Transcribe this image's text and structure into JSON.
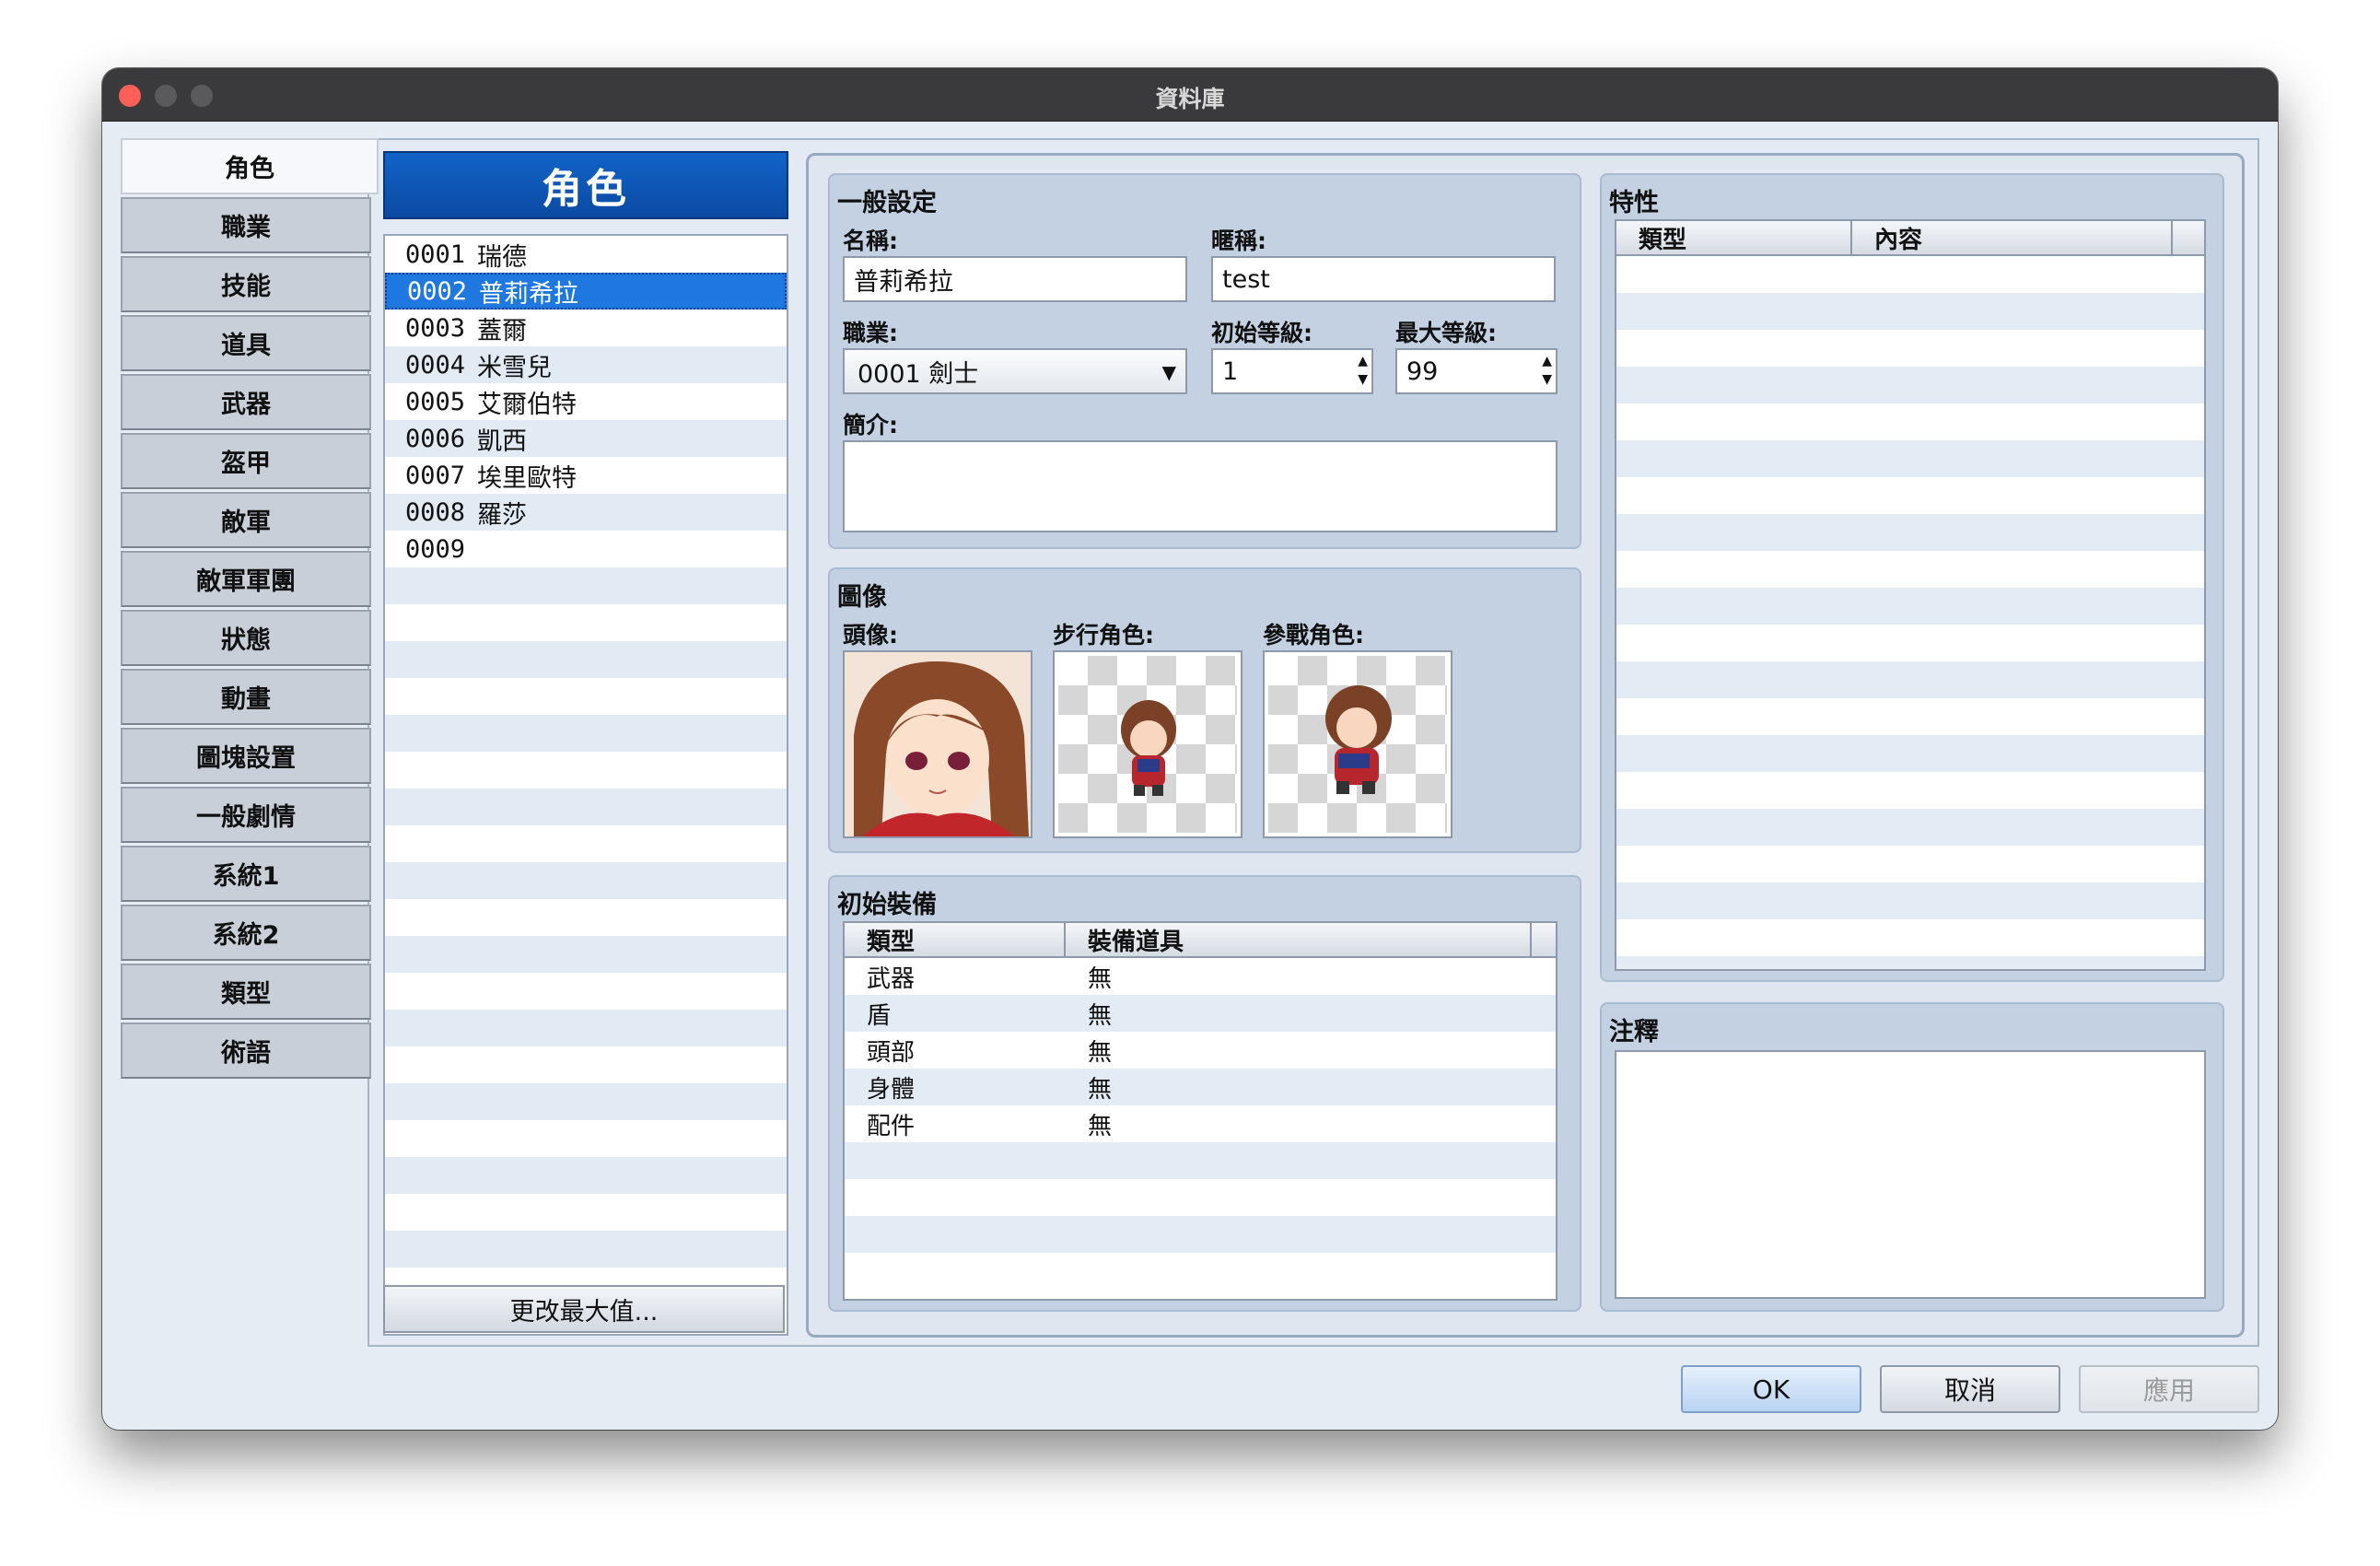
{
  "window": {
    "title": "資料庫"
  },
  "tabs": [
    {
      "label": "角色"
    },
    {
      "label": "職業"
    },
    {
      "label": "技能"
    },
    {
      "label": "道具"
    },
    {
      "label": "武器"
    },
    {
      "label": "盔甲"
    },
    {
      "label": "敵軍"
    },
    {
      "label": "敵軍軍團"
    },
    {
      "label": "狀態"
    },
    {
      "label": "動畫"
    },
    {
      "label": "圖塊設置"
    },
    {
      "label": "一般劇情"
    },
    {
      "label": "系統1"
    },
    {
      "label": "系統2"
    },
    {
      "label": "類型"
    },
    {
      "label": "術語"
    }
  ],
  "actor_list": {
    "header": "角色",
    "items": [
      {
        "id": "0001",
        "name": "瑞德"
      },
      {
        "id": "0002",
        "name": "普莉希拉"
      },
      {
        "id": "0003",
        "name": "蓋爾"
      },
      {
        "id": "0004",
        "name": "米雪兒"
      },
      {
        "id": "0005",
        "name": "艾爾伯特"
      },
      {
        "id": "0006",
        "name": "凱西"
      },
      {
        "id": "0007",
        "name": "埃里歐特"
      },
      {
        "id": "0008",
        "name": "羅莎"
      },
      {
        "id": "0009",
        "name": ""
      }
    ],
    "change_max_button": "更改最大值..."
  },
  "general": {
    "title": "一般設定",
    "name_label": "名稱:",
    "name_value": "普莉希拉",
    "nickname_label": "暱稱:",
    "nickname_value": "test",
    "class_label": "職業:",
    "class_value": "0001 劍士",
    "initial_level_label": "初始等級:",
    "initial_level_value": "1",
    "max_level_label": "最大等級:",
    "max_level_value": "99",
    "profile_label": "簡介:"
  },
  "images": {
    "title": "圖像",
    "face_label": "頭像:",
    "walk_label": "步行角色:",
    "battle_label": "參戰角色:"
  },
  "equipment": {
    "title": "初始裝備",
    "columns": [
      "類型",
      "裝備道具"
    ],
    "rows": [
      {
        "type": "武器",
        "item": "無"
      },
      {
        "type": "盾",
        "item": "無"
      },
      {
        "type": "頭部",
        "item": "無"
      },
      {
        "type": "身體",
        "item": "無"
      },
      {
        "type": "配件",
        "item": "無"
      }
    ]
  },
  "traits": {
    "title": "特性",
    "columns": [
      "類型",
      "內容"
    ]
  },
  "note": {
    "title": "注釋"
  },
  "buttons": {
    "ok": "OK",
    "cancel": "取消",
    "apply": "應用"
  }
}
